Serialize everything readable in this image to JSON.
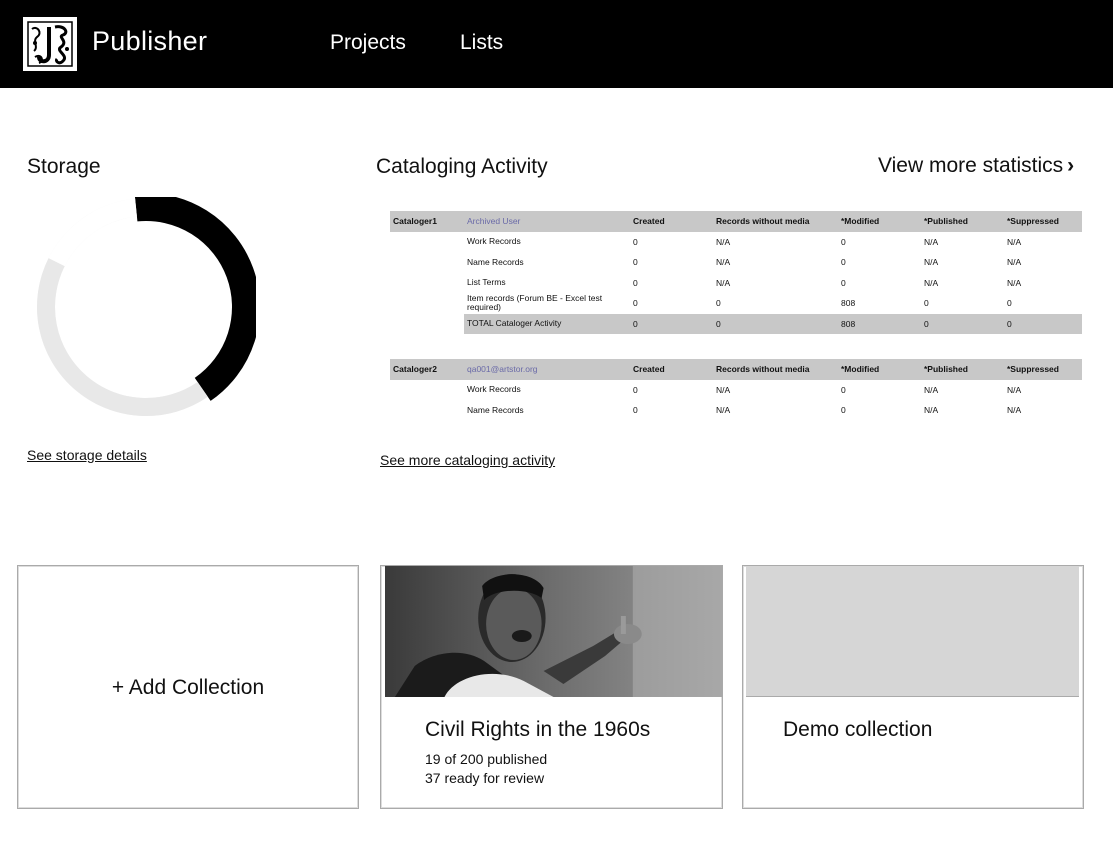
{
  "header": {
    "brand": "Publisher",
    "nav": [
      {
        "label": "Projects"
      },
      {
        "label": "Lists"
      }
    ]
  },
  "storage": {
    "title": "Storage",
    "details_link": "See storage details",
    "segments": [
      {
        "fraction": 0.42,
        "color": "#000000"
      },
      {
        "fraction": 0.42,
        "color": "#e8e8e8"
      },
      {
        "fraction": 0.16,
        "color": "#ffffff"
      }
    ]
  },
  "activity": {
    "title": "Cataloging Activity",
    "view_more": "View more statistics",
    "more_link": "See more cataloging activity",
    "columns": [
      "Created",
      "Records without media",
      "*Modified",
      "*Published",
      "*Suppressed"
    ],
    "groups": [
      {
        "cataloger": "Cataloger1",
        "user": "Archived User",
        "rows": [
          {
            "label": "Work Records",
            "values": [
              "0",
              "N/A",
              "0",
              "N/A",
              "N/A"
            ]
          },
          {
            "label": "Name Records",
            "values": [
              "0",
              "N/A",
              "0",
              "N/A",
              "N/A"
            ]
          },
          {
            "label": "List Terms",
            "values": [
              "0",
              "N/A",
              "0",
              "N/A",
              "N/A"
            ]
          },
          {
            "label": "Item records (Forum BE - Excel test required)",
            "values": [
              "0",
              "0",
              "808",
              "0",
              "0"
            ]
          },
          {
            "label": "TOTAL Cataloger Activity",
            "values": [
              "0",
              "0",
              "808",
              "0",
              "0"
            ],
            "total": true
          }
        ]
      },
      {
        "cataloger": "Cataloger2",
        "user": "qa001@artstor.org",
        "rows": [
          {
            "label": "Work Records",
            "values": [
              "0",
              "N/A",
              "0",
              "N/A",
              "N/A"
            ]
          },
          {
            "label": "Name Records",
            "values": [
              "0",
              "N/A",
              "0",
              "N/A",
              "N/A"
            ]
          }
        ]
      }
    ]
  },
  "collections": {
    "add_label": "+ Add Collection",
    "items": [
      {
        "title": "Civil Rights in the 1960s",
        "published": "19 of 200 published",
        "review": "37 ready for review"
      },
      {
        "title": "Demo collection"
      }
    ]
  },
  "colors": {
    "header_bg": "#000000",
    "table_head_bg": "#c8c8c8",
    "user_link": "#6a6aa8"
  },
  "icons": {
    "logo": "jstor-logo-icon",
    "chevron": "chevron-right-icon"
  }
}
